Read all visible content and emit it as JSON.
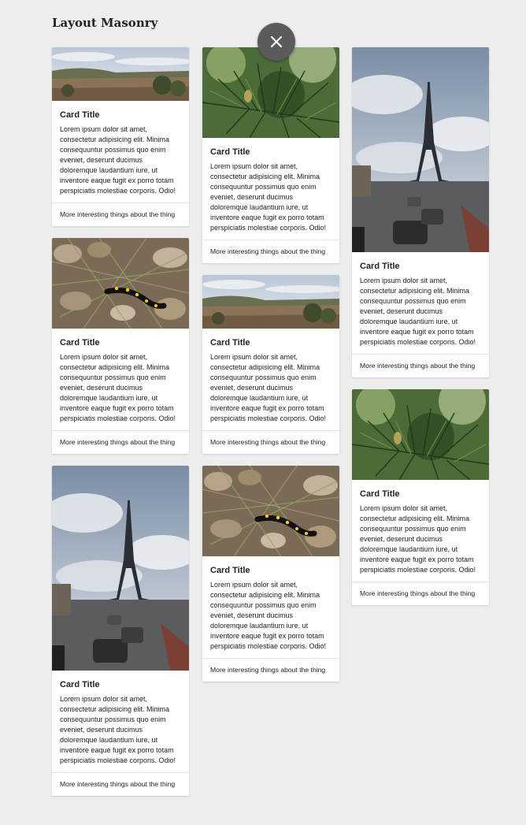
{
  "header": {
    "title": "Layout Masonry"
  },
  "close_button": {
    "icon": "close-icon"
  },
  "card_text": {
    "title": "Card Title",
    "body": "Lorem ipsum dolor sit amet, consectetur adipisicing elit. Minima consequuntur possimus quo enim eveniet, deserunt ducimus doloremque laudantium iure, ut inventore eaque fugit ex porro totam perspiciatis molestiae corporis. Odio!",
    "footer": "More interesting things about the thing"
  },
  "columns": [
    {
      "cards": [
        {
          "image": "landscape-image"
        },
        {
          "image": "salamander-image"
        },
        {
          "image": "eiffel-tower-image"
        }
      ]
    },
    {
      "cards": [
        {
          "image": "pine-branch-image"
        },
        {
          "image": "landscape-image"
        },
        {
          "image": "salamander-image"
        }
      ]
    },
    {
      "cards": [
        {
          "image": "eiffel-tower-image"
        },
        {
          "image": "pine-branch-image"
        }
      ]
    }
  ]
}
